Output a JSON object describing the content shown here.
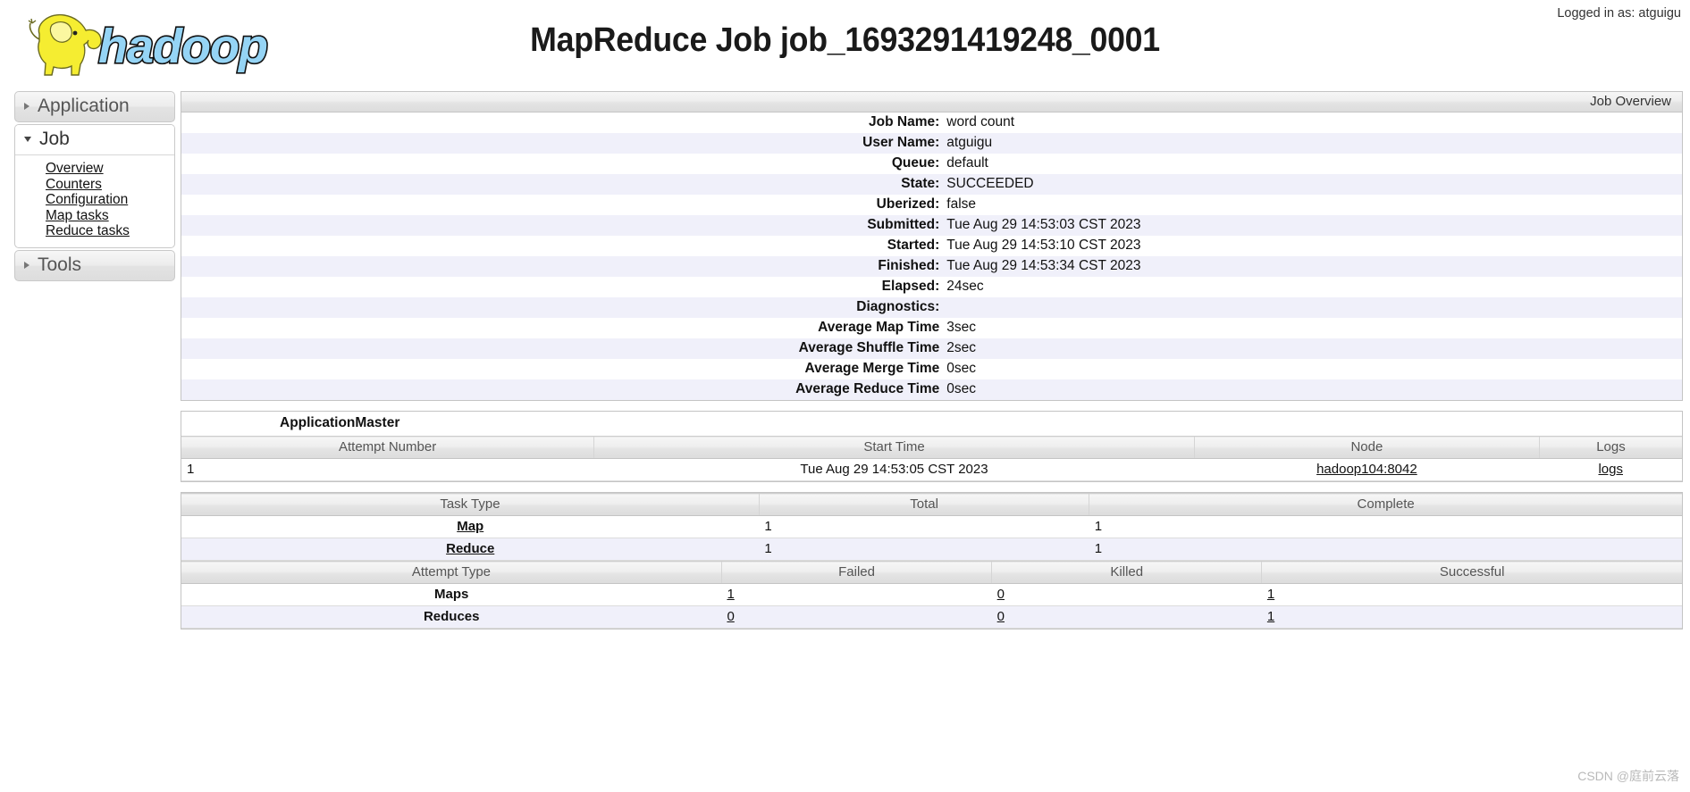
{
  "header": {
    "title": "MapReduce Job job_1693291419248_0001",
    "logged_in_label": "Logged in as: atguigu",
    "logo_alt": "hadoop",
    "logo_text": "hadoop"
  },
  "sidebar": {
    "application": {
      "label": "Application",
      "expanded": false,
      "icon": "chevron-right-icon"
    },
    "job": {
      "label": "Job",
      "expanded": true,
      "icon": "chevron-down-icon",
      "links": [
        {
          "label": "Overview"
        },
        {
          "label": "Counters"
        },
        {
          "label": "Configuration"
        },
        {
          "label": "Map tasks"
        },
        {
          "label": "Reduce tasks"
        }
      ]
    },
    "tools": {
      "label": "Tools",
      "expanded": false,
      "icon": "chevron-right-icon"
    }
  },
  "job_overview": {
    "caption": "Job Overview",
    "rows": [
      {
        "label": "Job Name:",
        "value": "word count"
      },
      {
        "label": "User Name:",
        "value": "atguigu"
      },
      {
        "label": "Queue:",
        "value": "default"
      },
      {
        "label": "State:",
        "value": "SUCCEEDED"
      },
      {
        "label": "Uberized:",
        "value": "false"
      },
      {
        "label": "Submitted:",
        "value": "Tue Aug 29 14:53:03 CST 2023"
      },
      {
        "label": "Started:",
        "value": "Tue Aug 29 14:53:10 CST 2023"
      },
      {
        "label": "Finished:",
        "value": "Tue Aug 29 14:53:34 CST 2023"
      },
      {
        "label": "Elapsed:",
        "value": "24sec"
      },
      {
        "label": "Diagnostics:",
        "value": ""
      },
      {
        "label": "Average Map Time",
        "value": "3sec"
      },
      {
        "label": "Average Shuffle Time",
        "value": "2sec"
      },
      {
        "label": "Average Merge Time",
        "value": "0sec"
      },
      {
        "label": "Average Reduce Time",
        "value": "0sec"
      }
    ]
  },
  "application_master": {
    "title": "ApplicationMaster",
    "columns": [
      "Attempt Number",
      "Start Time",
      "Node",
      "Logs"
    ],
    "rows": [
      {
        "attempt_number": "1",
        "start_time": "Tue Aug 29 14:53:05 CST 2023",
        "node": "hadoop104:8042",
        "logs": "logs"
      }
    ]
  },
  "task_summary": {
    "columns": [
      "Task Type",
      "Total",
      "Complete"
    ],
    "rows": [
      {
        "task_type": "Map",
        "total": "1",
        "complete": "1"
      },
      {
        "task_type": "Reduce",
        "total": "1",
        "complete": "1"
      }
    ]
  },
  "attempt_summary": {
    "columns": [
      "Attempt Type",
      "Failed",
      "Killed",
      "Successful"
    ],
    "rows": [
      {
        "attempt_type": "Maps",
        "failed": "1",
        "killed": "0",
        "successful": "1"
      },
      {
        "attempt_type": "Reduces",
        "failed": "0",
        "killed": "0",
        "successful": "1"
      }
    ]
  },
  "watermark": {
    "text": "CSDN @庭前云落"
  },
  "colors": {
    "row_alt": "#f0f0fa",
    "logo_yellow": "#f5ed31",
    "logo_blue": "#95d4f5",
    "panel_border": "#c4c4c4"
  }
}
